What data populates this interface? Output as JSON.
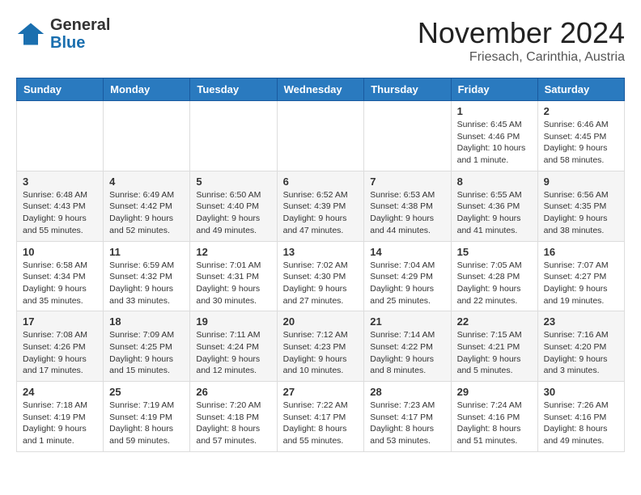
{
  "header": {
    "logo_general": "General",
    "logo_blue": "Blue",
    "month_year": "November 2024",
    "location": "Friesach, Carinthia, Austria"
  },
  "weekdays": [
    "Sunday",
    "Monday",
    "Tuesday",
    "Wednesday",
    "Thursday",
    "Friday",
    "Saturday"
  ],
  "weeks": [
    [
      {
        "day": "",
        "info": ""
      },
      {
        "day": "",
        "info": ""
      },
      {
        "day": "",
        "info": ""
      },
      {
        "day": "",
        "info": ""
      },
      {
        "day": "",
        "info": ""
      },
      {
        "day": "1",
        "info": "Sunrise: 6:45 AM\nSunset: 4:46 PM\nDaylight: 10 hours and 1 minute."
      },
      {
        "day": "2",
        "info": "Sunrise: 6:46 AM\nSunset: 4:45 PM\nDaylight: 9 hours and 58 minutes."
      }
    ],
    [
      {
        "day": "3",
        "info": "Sunrise: 6:48 AM\nSunset: 4:43 PM\nDaylight: 9 hours and 55 minutes."
      },
      {
        "day": "4",
        "info": "Sunrise: 6:49 AM\nSunset: 4:42 PM\nDaylight: 9 hours and 52 minutes."
      },
      {
        "day": "5",
        "info": "Sunrise: 6:50 AM\nSunset: 4:40 PM\nDaylight: 9 hours and 49 minutes."
      },
      {
        "day": "6",
        "info": "Sunrise: 6:52 AM\nSunset: 4:39 PM\nDaylight: 9 hours and 47 minutes."
      },
      {
        "day": "7",
        "info": "Sunrise: 6:53 AM\nSunset: 4:38 PM\nDaylight: 9 hours and 44 minutes."
      },
      {
        "day": "8",
        "info": "Sunrise: 6:55 AM\nSunset: 4:36 PM\nDaylight: 9 hours and 41 minutes."
      },
      {
        "day": "9",
        "info": "Sunrise: 6:56 AM\nSunset: 4:35 PM\nDaylight: 9 hours and 38 minutes."
      }
    ],
    [
      {
        "day": "10",
        "info": "Sunrise: 6:58 AM\nSunset: 4:34 PM\nDaylight: 9 hours and 35 minutes."
      },
      {
        "day": "11",
        "info": "Sunrise: 6:59 AM\nSunset: 4:32 PM\nDaylight: 9 hours and 33 minutes."
      },
      {
        "day": "12",
        "info": "Sunrise: 7:01 AM\nSunset: 4:31 PM\nDaylight: 9 hours and 30 minutes."
      },
      {
        "day": "13",
        "info": "Sunrise: 7:02 AM\nSunset: 4:30 PM\nDaylight: 9 hours and 27 minutes."
      },
      {
        "day": "14",
        "info": "Sunrise: 7:04 AM\nSunset: 4:29 PM\nDaylight: 9 hours and 25 minutes."
      },
      {
        "day": "15",
        "info": "Sunrise: 7:05 AM\nSunset: 4:28 PM\nDaylight: 9 hours and 22 minutes."
      },
      {
        "day": "16",
        "info": "Sunrise: 7:07 AM\nSunset: 4:27 PM\nDaylight: 9 hours and 19 minutes."
      }
    ],
    [
      {
        "day": "17",
        "info": "Sunrise: 7:08 AM\nSunset: 4:26 PM\nDaylight: 9 hours and 17 minutes."
      },
      {
        "day": "18",
        "info": "Sunrise: 7:09 AM\nSunset: 4:25 PM\nDaylight: 9 hours and 15 minutes."
      },
      {
        "day": "19",
        "info": "Sunrise: 7:11 AM\nSunset: 4:24 PM\nDaylight: 9 hours and 12 minutes."
      },
      {
        "day": "20",
        "info": "Sunrise: 7:12 AM\nSunset: 4:23 PM\nDaylight: 9 hours and 10 minutes."
      },
      {
        "day": "21",
        "info": "Sunrise: 7:14 AM\nSunset: 4:22 PM\nDaylight: 9 hours and 8 minutes."
      },
      {
        "day": "22",
        "info": "Sunrise: 7:15 AM\nSunset: 4:21 PM\nDaylight: 9 hours and 5 minutes."
      },
      {
        "day": "23",
        "info": "Sunrise: 7:16 AM\nSunset: 4:20 PM\nDaylight: 9 hours and 3 minutes."
      }
    ],
    [
      {
        "day": "24",
        "info": "Sunrise: 7:18 AM\nSunset: 4:19 PM\nDaylight: 9 hours and 1 minute."
      },
      {
        "day": "25",
        "info": "Sunrise: 7:19 AM\nSunset: 4:19 PM\nDaylight: 8 hours and 59 minutes."
      },
      {
        "day": "26",
        "info": "Sunrise: 7:20 AM\nSunset: 4:18 PM\nDaylight: 8 hours and 57 minutes."
      },
      {
        "day": "27",
        "info": "Sunrise: 7:22 AM\nSunset: 4:17 PM\nDaylight: 8 hours and 55 minutes."
      },
      {
        "day": "28",
        "info": "Sunrise: 7:23 AM\nSunset: 4:17 PM\nDaylight: 8 hours and 53 minutes."
      },
      {
        "day": "29",
        "info": "Sunrise: 7:24 AM\nSunset: 4:16 PM\nDaylight: 8 hours and 51 minutes."
      },
      {
        "day": "30",
        "info": "Sunrise: 7:26 AM\nSunset: 4:16 PM\nDaylight: 8 hours and 49 minutes."
      }
    ]
  ]
}
